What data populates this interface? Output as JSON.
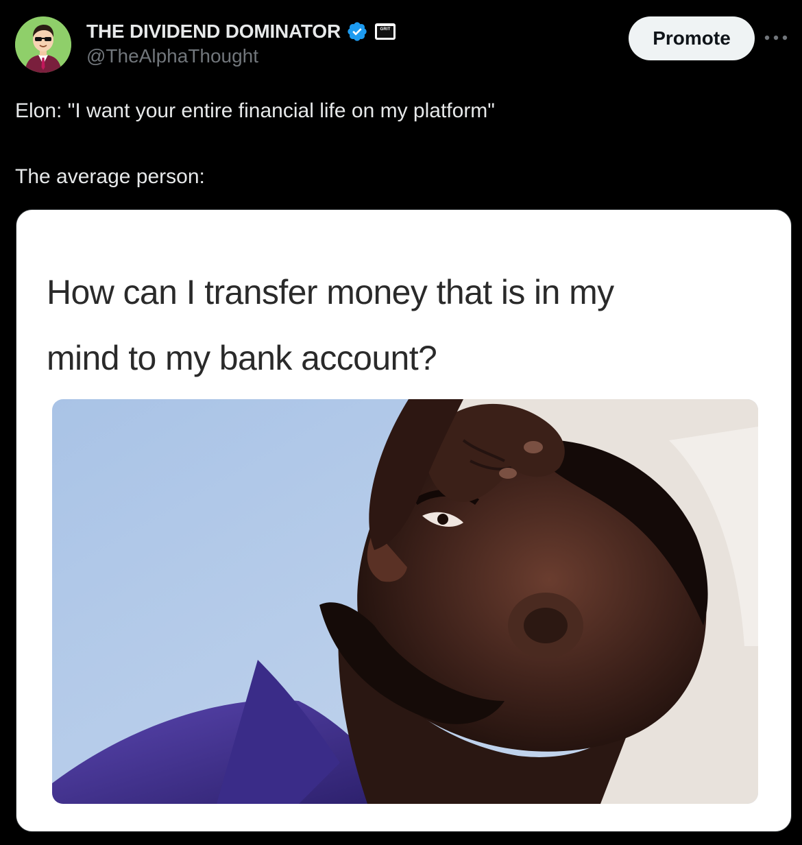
{
  "author": {
    "display_name": "THE DIVIDEND DOMINATOR",
    "handle": "@TheAlphaThought",
    "verified": true,
    "affiliate_badge_text": "GRIT",
    "avatar_icon": "cartoon-businessman-avatar"
  },
  "actions": {
    "promote_label": "Promote",
    "more_icon": "more-horizontal-icon"
  },
  "tweet": {
    "line1": "Elon: \"I want your entire financial life on my platform\"",
    "line2": "The average person:"
  },
  "media": {
    "caption_line1": "How can I transfer money that is in my",
    "caption_line2": "mind to my bank account?",
    "photo": "man-lying-down-thinking-photo"
  },
  "colors": {
    "background": "#000000",
    "text_primary": "#e7e9ea",
    "text_secondary": "#71767b",
    "verified_blue": "#1d9bf0",
    "promote_bg": "#eff3f4"
  }
}
